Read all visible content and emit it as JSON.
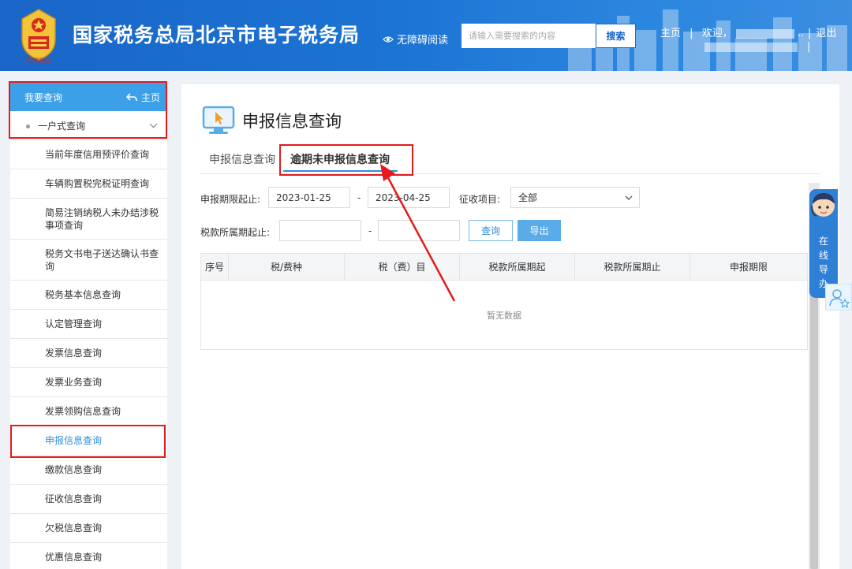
{
  "header": {
    "title": "国家税务总局北京市电子税务局",
    "emblem_text": "中国税务",
    "accessibility_label": "无障碍阅读",
    "search_placeholder": "请输入需要搜索的内容",
    "search_button": "搜索",
    "nav_home": "主页",
    "nav_sep": "|",
    "welcome": "欢迎，",
    "welcome_tail": "..",
    "logout": "退出"
  },
  "sidebar": {
    "header_label": "我要查询",
    "home_label": "主页",
    "group_label": "一户式查询",
    "items": [
      "当前年度信用预评价查询",
      "车辆购置税完税证明查询",
      "简易注销纳税人未办结涉税事项查询",
      "税务文书电子送达确认书查询",
      "税务基本信息查询",
      "认定管理查询",
      "发票信息查询",
      "发票业务查询",
      "发票领购信息查询",
      "申报信息查询",
      "缴款信息查询",
      "征收信息查询",
      "欠税信息查询",
      "优惠信息查询"
    ],
    "active_index": 9
  },
  "main": {
    "page_title": "申报信息查询",
    "tabs": [
      {
        "label": "申报信息查询"
      },
      {
        "label": "逾期未申报信息查询"
      }
    ],
    "active_tab": 1,
    "form": {
      "period_label": "申报期限起止:",
      "period_start": "2023-01-25",
      "period_end": "2023-04-25",
      "range_sep": "-",
      "item_label": "征收项目:",
      "item_value": "全部",
      "tax_period_label": "税款所属期起止:",
      "tax_period_start": "",
      "tax_period_end": "",
      "query_button": "查询",
      "export_button": "导出"
    },
    "table": {
      "columns": [
        "序号",
        "税/费种",
        "税（费）目",
        "税款所属期起",
        "税款所属期止",
        "申报期限"
      ],
      "empty_text": "暂无数据"
    }
  },
  "assistant": {
    "label": "在线导办"
  },
  "colors": {
    "header_blue": "#1a66c8",
    "sidebar_header": "#3ca0e8",
    "accent": "#2e8ede",
    "highlight_red": "#e31b1b"
  }
}
